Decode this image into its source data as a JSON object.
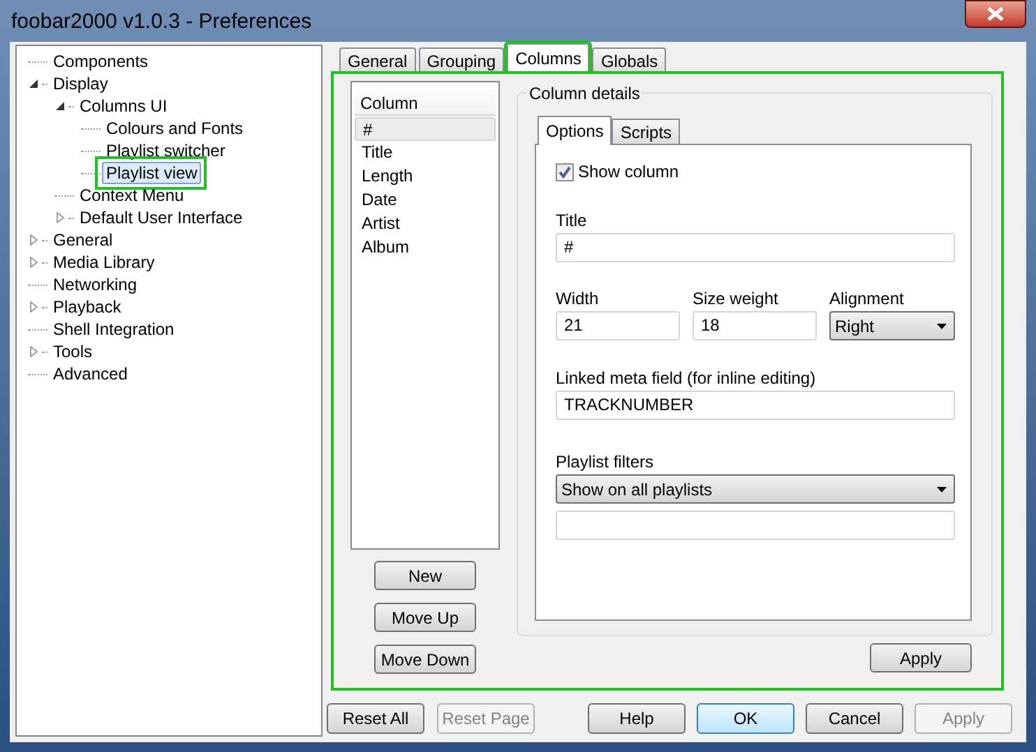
{
  "window": {
    "title": "foobar2000 v1.0.3 - Preferences"
  },
  "tree": [
    {
      "label": "Components",
      "selected": false,
      "highlighted": false
    },
    {
      "label": "Display",
      "selected": false,
      "highlighted": false,
      "expanded": true,
      "children": [
        {
          "label": "Columns UI",
          "selected": false,
          "highlighted": false,
          "expanded": true,
          "children": [
            {
              "label": "Colours and Fonts",
              "selected": false,
              "highlighted": false
            },
            {
              "label": "Playlist switcher",
              "selected": false,
              "highlighted": false
            },
            {
              "label": "Playlist view",
              "selected": true,
              "highlighted": true
            }
          ]
        },
        {
          "label": "Context Menu",
          "selected": false,
          "highlighted": false
        },
        {
          "label": "Default User Interface",
          "selected": false,
          "highlighted": false,
          "expanded": false
        }
      ]
    },
    {
      "label": "General",
      "selected": false,
      "highlighted": false,
      "expanded": false
    },
    {
      "label": "Media Library",
      "selected": false,
      "highlighted": false,
      "expanded": false
    },
    {
      "label": "Networking",
      "selected": false,
      "highlighted": false
    },
    {
      "label": "Playback",
      "selected": false,
      "highlighted": false,
      "expanded": false
    },
    {
      "label": "Shell Integration",
      "selected": false,
      "highlighted": false
    },
    {
      "label": "Tools",
      "selected": false,
      "highlighted": false,
      "expanded": false
    },
    {
      "label": "Advanced",
      "selected": false,
      "highlighted": false
    }
  ],
  "tabs": [
    {
      "label": "General",
      "selected": false,
      "highlighted": false
    },
    {
      "label": "Grouping",
      "selected": false,
      "highlighted": false
    },
    {
      "label": "Columns",
      "selected": true,
      "highlighted": true
    },
    {
      "label": "Globals",
      "selected": false,
      "highlighted": false
    }
  ],
  "panel_highlighted": true,
  "column_list": {
    "header": "Column",
    "items": [
      {
        "label": "#",
        "selected": true
      },
      {
        "label": "Title",
        "selected": false
      },
      {
        "label": "Length",
        "selected": false
      },
      {
        "label": "Date",
        "selected": false
      },
      {
        "label": "Artist",
        "selected": false
      },
      {
        "label": "Album",
        "selected": false
      }
    ]
  },
  "list_buttons": [
    "New",
    "Move Up",
    "Move Down"
  ],
  "column_details": {
    "title": "Column details",
    "tabs": [
      {
        "label": "Options",
        "selected": true
      },
      {
        "label": "Scripts",
        "selected": false
      }
    ],
    "show_column": {
      "label": "Show column",
      "checked": true
    },
    "title_field": {
      "label": "Title",
      "value": "#"
    },
    "width_field": {
      "label": "Width",
      "value": "21"
    },
    "size_weight_field": {
      "label": "Size weight",
      "value": "18"
    },
    "alignment": {
      "label": "Alignment",
      "value": "Right"
    },
    "linked_meta_field": {
      "label": "Linked meta field (for inline editing)",
      "value": "TRACKNUMBER"
    },
    "playlist_filters": {
      "label": "Playlist filters",
      "value": "Show on all playlists"
    },
    "apply_button": "Apply"
  },
  "footer_buttons": [
    {
      "label": "Reset All",
      "disabled": false,
      "default": false
    },
    {
      "label": "Reset Page",
      "disabled": true,
      "default": false
    },
    {
      "label": "Help",
      "disabled": false,
      "default": false
    },
    {
      "label": "OK",
      "disabled": false,
      "default": true
    },
    {
      "label": "Cancel",
      "disabled": false,
      "default": false
    },
    {
      "label": "Apply",
      "disabled": true,
      "default": false
    }
  ]
}
